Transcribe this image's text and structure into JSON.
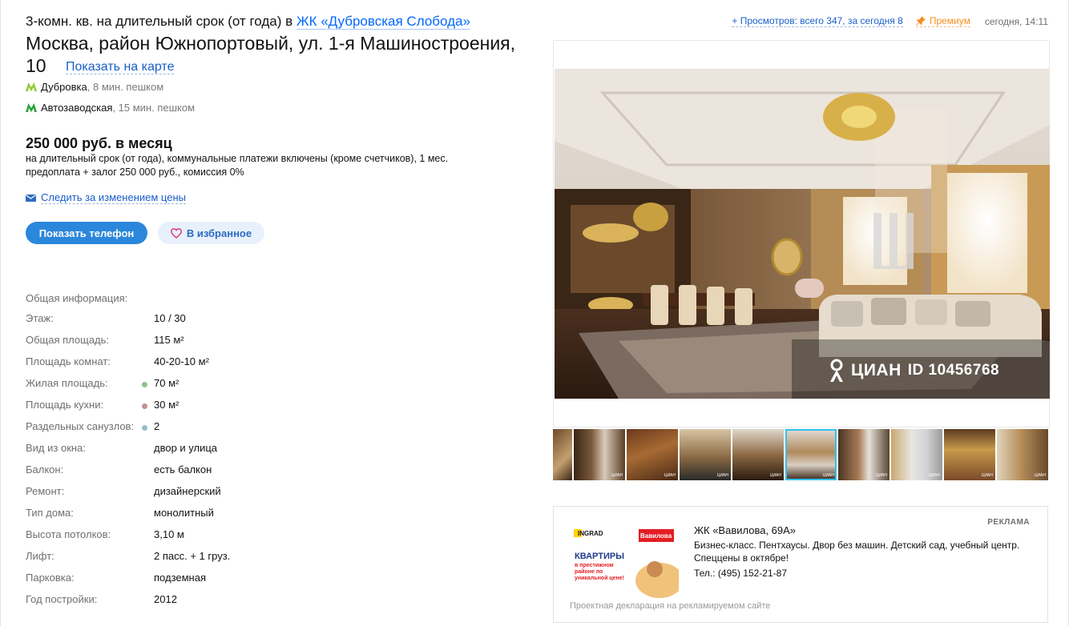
{
  "header": {
    "title_prefix": "3-комн. кв. на длительный срок (от года) в",
    "complex_link": "ЖК «Дубровская Слобода»",
    "address": "Москва, район Южнопортовый, ул. 1-я Машиностроения, 10",
    "show_on_map": "Показать на карте"
  },
  "metro": [
    {
      "station": "Дубровка",
      "distance": ", 8 мин. пешком",
      "color": "#8fcb3d"
    },
    {
      "station": "Автозаводская",
      "distance": ", 15 мин. пешком",
      "color": "#2da33b"
    }
  ],
  "offer": {
    "price": "250 000 руб. в месяц",
    "terms": "на длительный срок (от года), коммунальные платежи включены (кроме счетчиков), 1 мес. предоплата + залог 250 000 руб., комиссия 0%",
    "follow_price": "Следить за изменением цены",
    "show_phone": "Показать телефон",
    "favorite": "В избранное"
  },
  "meta": {
    "views": "+ Просмотров: всего 347, за сегодня 8",
    "premium": "Премиум",
    "date": "сегодня, 14:11"
  },
  "info": {
    "heading": "Общая информация:",
    "rows": [
      {
        "k": "Этаж:",
        "v": "10 / 30",
        "dot": ""
      },
      {
        "k": "Общая площадь:",
        "v": "115 м²",
        "dot": ""
      },
      {
        "k": "Площадь комнат:",
        "v": "40-20-10 м²",
        "dot": ""
      },
      {
        "k": "Жилая площадь:",
        "v": "70 м²",
        "dot": "#8dc18d"
      },
      {
        "k": "Площадь кухни:",
        "v": "30 м²",
        "dot": "#c48f8f"
      },
      {
        "k": "Раздельных санузлов:",
        "v": "2",
        "dot": "#8fc1c8"
      },
      {
        "k": "Вид из окна:",
        "v": "двор и улица",
        "dot": ""
      },
      {
        "k": "Балкон:",
        "v": "есть балкон",
        "dot": ""
      },
      {
        "k": "Ремонт:",
        "v": "дизайнерский",
        "dot": ""
      },
      {
        "k": "Тип дома:",
        "v": "монолитный",
        "dot": ""
      },
      {
        "k": "Высота потолков:",
        "v": "3,10 м",
        "dot": ""
      },
      {
        "k": "Лифт:",
        "v": "2 пасс. + 1 груз.",
        "dot": ""
      },
      {
        "k": "Парковка:",
        "v": "подземная",
        "dot": ""
      },
      {
        "k": "Год постройки:",
        "v": "2012",
        "dot": ""
      }
    ]
  },
  "photo": {
    "watermark_brand": "ЦИАН",
    "watermark_id": "ID 10456768"
  },
  "thumbnails": {
    "count": 10,
    "active_index": 5,
    "tag": "ЦИАН"
  },
  "ad": {
    "label": "РЕКЛАМА",
    "title": "ЖК «Вавилова, 69А»",
    "description": "Бизнес-класс. Пентхаусы. Двор без машин. Детский сад, учебный центр. Спеццены в октябре!",
    "phone": "Тел.: (495) 152-21-87",
    "footer": "Проектная декларация на рекламируемом сайте",
    "banner_brand": "INGRAD",
    "banner_logo": "Вавилова",
    "banner_headline": "КВАРТИРЫ",
    "banner_subline": "в престижном районе по уникальной цене!"
  }
}
